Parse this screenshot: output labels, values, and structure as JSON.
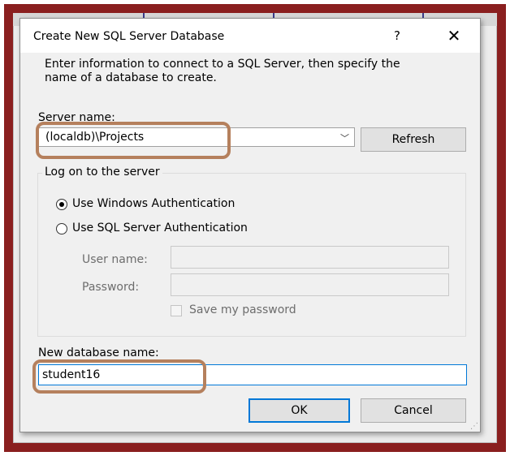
{
  "dialog": {
    "title": "Create New SQL Server Database",
    "help_label": "?",
    "close_label": "✕",
    "instructions_line1": "Enter information to connect to a SQL Server, then specify the",
    "instructions_line2": "name of a database to create."
  },
  "server": {
    "label": "Server name:",
    "value": "(localdb)\\Projects",
    "refresh_label": "Refresh"
  },
  "logon": {
    "legend": "Log on to the server",
    "windows_auth_label": "Use Windows Authentication",
    "sql_auth_label": "Use SQL Server Authentication",
    "selected": "windows",
    "username_label": "User name:",
    "username_value": "",
    "password_label": "Password:",
    "password_value": "",
    "save_password_label": "Save my password",
    "save_password_checked": false
  },
  "database": {
    "label": "New database name:",
    "value": "student16"
  },
  "buttons": {
    "ok_label": "OK",
    "cancel_label": "Cancel"
  },
  "annotations": {
    "highlight_color": "#b5805d",
    "frame_color": "#8a1f1f"
  }
}
